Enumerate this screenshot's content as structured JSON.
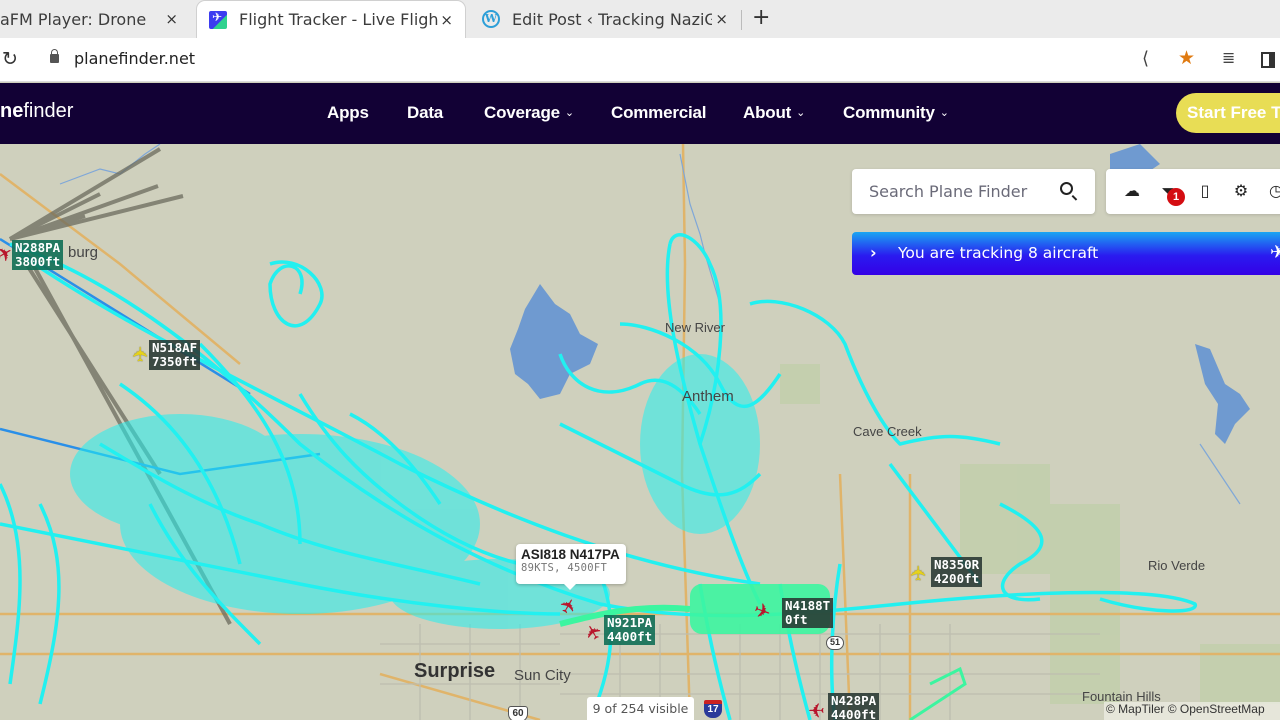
{
  "browser": {
    "tabs": [
      {
        "title": "aFM Player: Drone Zo",
        "icon": "radio-favicon",
        "active": false
      },
      {
        "title": "Flight Tracker - Live Flight",
        "icon": "planefinder-favicon",
        "active": true
      },
      {
        "title": "Edit Post ‹ Tracking NaziG",
        "icon": "wordpress-favicon",
        "active": false
      }
    ],
    "close_glyph": "×",
    "new_tab_glyph": "+",
    "url": "planefinder.net",
    "reload_glyph": "C",
    "share_glyph": "<",
    "star_glyph": "★",
    "playlist_glyph": "≡♪"
  },
  "site": {
    "logo_bold": "ne",
    "logo_rest": "finder",
    "nav": [
      {
        "label": "Apps",
        "dropdown": false
      },
      {
        "label": "Data",
        "dropdown": false
      },
      {
        "label": "Coverage",
        "dropdown": true
      },
      {
        "label": "Commercial",
        "dropdown": false
      },
      {
        "label": "About",
        "dropdown": true
      },
      {
        "label": "Community",
        "dropdown": true
      }
    ],
    "chevron_glyph": "⌄",
    "cta_label": "Start Free Tri"
  },
  "map": {
    "search_placeholder": "Search Plane Finder",
    "tools": [
      {
        "name": "weather-cloud-icon",
        "glyph": "☁"
      },
      {
        "name": "filter-icon",
        "glyph": "⏷"
      },
      {
        "name": "bookmark-icon",
        "glyph": "🔖"
      },
      {
        "name": "settings-gear-icon",
        "glyph": "⚙"
      },
      {
        "name": "history-clock-icon",
        "glyph": "🕘"
      }
    ],
    "filter_badge": "1",
    "tracking_text": "You are tracking 8 aircraft",
    "tracking_arrow": "›",
    "visible_count": "9 of 254 visible",
    "attribution": "© MapTiler © OpenStreetMap",
    "popup": {
      "title": "ASI818 N417PA",
      "subtitle": "89KTS,  4500FT"
    },
    "aircraft": [
      {
        "reg": "N288PA",
        "alt": "3800ft",
        "color": "red"
      },
      {
        "reg": "N518AF",
        "alt": "7350ft",
        "color": "yellow"
      },
      {
        "reg": "N921PA",
        "alt": "4400ft",
        "color": "red"
      },
      {
        "reg": "N4188T",
        "alt": "0ft",
        "color": "red"
      },
      {
        "reg": "N8350R",
        "alt": "4200ft",
        "color": "yellow"
      },
      {
        "reg": "N428PA",
        "alt": "4400ft",
        "color": "red"
      },
      {
        "reg": "N417PA",
        "alt": "4500ft",
        "color": "red"
      }
    ],
    "places": [
      {
        "name": "burg"
      },
      {
        "name": "New River"
      },
      {
        "name": "Anthem"
      },
      {
        "name": "Cave Creek"
      },
      {
        "name": "Rio Verde"
      },
      {
        "name": "Surprise"
      },
      {
        "name": "Sun City"
      },
      {
        "name": "Fountain Hills"
      }
    ],
    "shields": {
      "i17": "17",
      "us60": "60",
      "r51": "51"
    },
    "colors": {
      "track_cyan": "#22f0f0",
      "track_green": "#3cf5a0",
      "track_blue": "#2a8fe8",
      "track_gray": "#6b6b5e",
      "water": "#6f9ad0",
      "land": "#cfd0bd"
    }
  }
}
